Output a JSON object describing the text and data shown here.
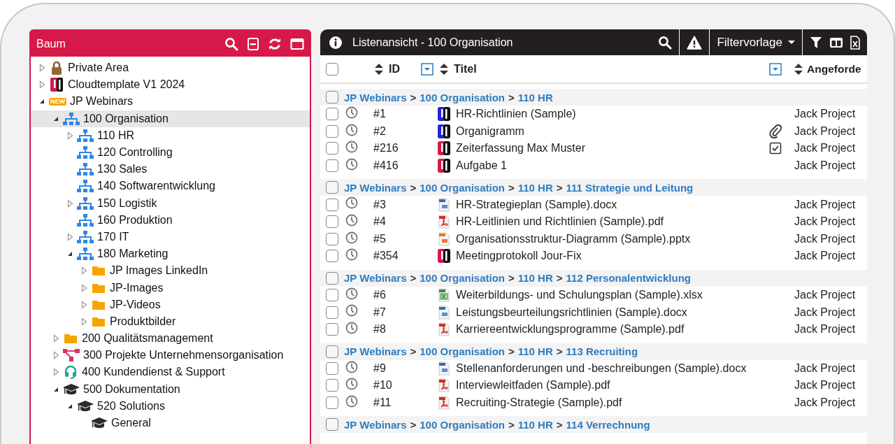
{
  "tree": {
    "title": "Baum",
    "items": [
      {
        "label": "Private Area",
        "kind": "lock",
        "expanded": false,
        "selected": false
      },
      {
        "label": "Cloudtemplate V1 2024",
        "kind": "logo",
        "expanded": false,
        "selected": false
      },
      {
        "label": "JP Webinars",
        "kind": "badge",
        "badge": "NEW",
        "expanded": true,
        "selected": false,
        "children": [
          {
            "label": "100 Organisation",
            "kind": "org",
            "expanded": true,
            "selected": true,
            "children": [
              {
                "label": "110 HR",
                "kind": "org",
                "expanded": false,
                "selected": false
              },
              {
                "label": "120 Controlling",
                "kind": "org",
                "selected": false
              },
              {
                "label": "130 Sales",
                "kind": "org",
                "selected": false
              },
              {
                "label": "140 Softwarentwicklung",
                "kind": "org",
                "selected": false
              },
              {
                "label": "150 Logistik",
                "kind": "org",
                "expanded": false,
                "selected": false
              },
              {
                "label": "160 Produktion",
                "kind": "org",
                "selected": false
              },
              {
                "label": "170 IT",
                "kind": "org",
                "expanded": false,
                "selected": false
              },
              {
                "label": "180 Marketing",
                "kind": "org",
                "expanded": true,
                "selected": false,
                "children": [
                  {
                    "label": "JP Images LinkedIn",
                    "kind": "folder",
                    "expanded": false,
                    "selected": false
                  },
                  {
                    "label": "JP-Images",
                    "kind": "folder",
                    "expanded": false,
                    "selected": false
                  },
                  {
                    "label": "JP-Videos",
                    "kind": "folder",
                    "expanded": false,
                    "selected": false
                  },
                  {
                    "label": "Produktbilder",
                    "kind": "folder",
                    "expanded": false,
                    "selected": false
                  }
                ]
              }
            ]
          },
          {
            "label": "200 Qualitätsmanagement",
            "kind": "folder",
            "expanded": false,
            "selected": false
          },
          {
            "label": "300 Projekte Unternehmensorganisation",
            "kind": "network",
            "expanded": false,
            "selected": false
          },
          {
            "label": "400 Kundendienst & Support",
            "kind": "headset",
            "expanded": false,
            "selected": false
          },
          {
            "label": "500 Dokumentation",
            "kind": "cap",
            "expanded": true,
            "selected": false,
            "children": [
              {
                "label": "520 Solutions",
                "kind": "cap",
                "expanded": true,
                "selected": false,
                "children": [
                  {
                    "label": "General",
                    "kind": "cap",
                    "selected": false
                  }
                ]
              }
            ]
          }
        ]
      }
    ]
  },
  "list": {
    "title": "Listenansicht - 100 Organisation",
    "filter_template": "Filtervorlage",
    "select_all": {
      "checked": false
    },
    "columns": [
      {
        "label": "ID"
      },
      {
        "label": "Titel"
      },
      {
        "label": "Angeforde"
      }
    ],
    "separator": ">",
    "groups": [
      {
        "path": [
          "JP Webinars",
          "100 Organisation",
          "110 HR"
        ],
        "checked": false,
        "items": [
          {
            "id": "#1",
            "kind": "logoblue",
            "title": "HR-Richtlinien (Sample)",
            "requester": "Jack Project",
            "checked": false
          },
          {
            "id": "#2",
            "kind": "logoblue",
            "title": "Organigramm",
            "status_icon": {
              "kind": "attachment"
            },
            "requester": "Jack Project",
            "checked": false
          },
          {
            "id": "#216",
            "kind": "logored",
            "title": "Zeiterfassung Max Muster",
            "status_icon": {
              "kind": "task"
            },
            "requester": "Jack Project",
            "checked": false
          },
          {
            "id": "#416",
            "kind": "logored",
            "title": "Aufgabe 1",
            "requester": "Jack Project",
            "checked": false
          }
        ]
      },
      {
        "path": [
          "JP Webinars",
          "100 Organisation",
          "110 HR",
          "111 Strategie und Leitung"
        ],
        "checked": false,
        "items": [
          {
            "id": "#3",
            "kind": "docx",
            "title": "HR-Strategieplan (Sample).docx",
            "requester": "Jack Project",
            "checked": false
          },
          {
            "id": "#4",
            "kind": "pdf",
            "title": "HR-Leitlinien und Richtlinien (Sample).pdf",
            "requester": "Jack Project",
            "checked": false
          },
          {
            "id": "#5",
            "kind": "pptx",
            "title": "Organisationsstruktur-Diagramm (Sample).pptx",
            "requester": "Jack Project",
            "checked": false
          },
          {
            "id": "#354",
            "kind": "logored",
            "title": "Meetingprotokoll Jour-Fix",
            "requester": "Jack Project",
            "checked": false
          }
        ]
      },
      {
        "path": [
          "JP Webinars",
          "100 Organisation",
          "110 HR",
          "112 Personalentwicklung"
        ],
        "checked": false,
        "items": [
          {
            "id": "#6",
            "kind": "xlsx",
            "title": "Weiterbildungs- und Schulungsplan (Sample).xlsx",
            "requester": "Jack Project",
            "checked": false
          },
          {
            "id": "#7",
            "kind": "docx",
            "title": "Leistungsbeurteilungsrichtlinien (Sample).docx",
            "requester": "Jack Project",
            "checked": false
          },
          {
            "id": "#8",
            "kind": "pdf",
            "title": "Karriereentwicklungsprogramme (Sample).pdf",
            "requester": "Jack Project",
            "checked": false
          }
        ]
      },
      {
        "path": [
          "JP Webinars",
          "100 Organisation",
          "110 HR",
          "113 Recruiting"
        ],
        "checked": false,
        "items": [
          {
            "id": "#9",
            "kind": "docx",
            "title": "Stellenanforderungen und -beschreibungen (Sample).docx",
            "requester": "Jack Project",
            "checked": false
          },
          {
            "id": "#10",
            "kind": "pdf",
            "title": "Interviewleitfaden (Sample).pdf",
            "requester": "Jack Project",
            "checked": false
          },
          {
            "id": "#11",
            "kind": "pdf",
            "title": "Recruiting-Strategie (Sample).pdf",
            "requester": "Jack Project",
            "checked": false
          }
        ]
      },
      {
        "path": [
          "JP Webinars",
          "100 Organisation",
          "110 HR",
          "114 Verrechnung"
        ],
        "checked": false
      }
    ]
  }
}
